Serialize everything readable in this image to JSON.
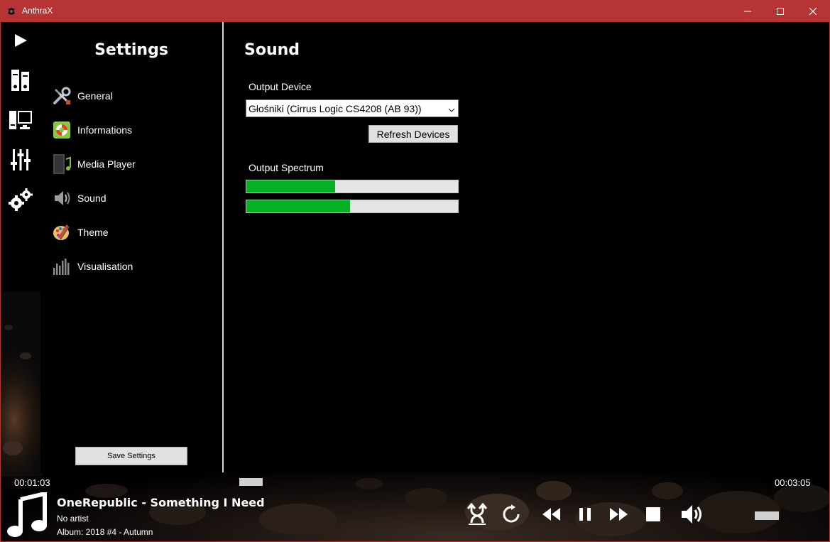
{
  "window": {
    "title": "AnthraX",
    "titlebar_color": "#b73434"
  },
  "nav": {
    "items": [
      {
        "icon": "play-icon"
      },
      {
        "icon": "library-icon"
      },
      {
        "icon": "screen-icon"
      },
      {
        "icon": "equalizer-icon"
      },
      {
        "icon": "gears-icon"
      }
    ]
  },
  "settings": {
    "title": "Settings",
    "categories": [
      {
        "label": "General",
        "icon": "tools-icon"
      },
      {
        "label": "Informations",
        "icon": "lifebuoy-icon"
      },
      {
        "label": "Media Player",
        "icon": "media-player-icon"
      },
      {
        "label": "Sound",
        "icon": "speaker-icon"
      },
      {
        "label": "Theme",
        "icon": "palette-icon"
      },
      {
        "label": "Visualisation",
        "icon": "visualisation-icon"
      }
    ],
    "save_label": "Save Settings"
  },
  "sound": {
    "title": "Sound",
    "output_device_label": "Output Device",
    "output_device_value": "Głośniki (Cirrus Logic CS4208 (AB 93))",
    "refresh_label": "Refresh Devices",
    "output_spectrum_label": "Output Spectrum",
    "spectrum_levels": [
      0.42,
      0.49
    ],
    "meter_color": "#06b025"
  },
  "player": {
    "elapsed": "00:01:03",
    "duration": "00:03:05",
    "track_title": "OneRepublic - Something I Need",
    "artist": "No artist",
    "album": "Album: 2018 #4 - Autumn",
    "controls": [
      "shuffle-icon",
      "repeat-icon",
      "rewind-icon",
      "pause-icon",
      "fast-forward-icon",
      "stop-icon",
      "volume-icon"
    ]
  }
}
